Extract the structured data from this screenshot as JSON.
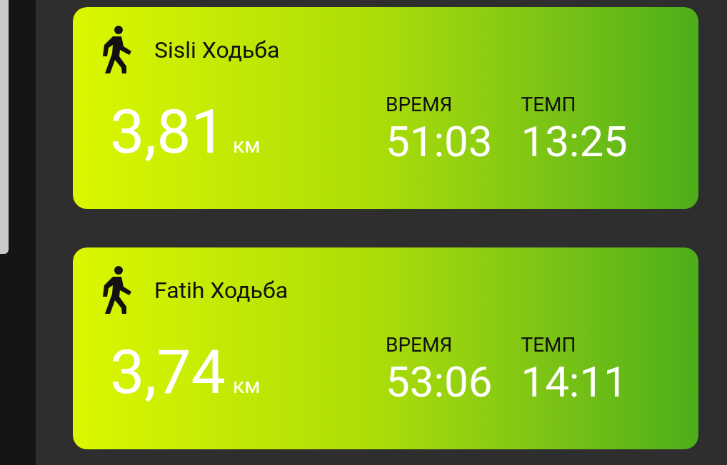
{
  "activities": [
    {
      "title": "Sisli Ходьба",
      "distance": "3,81",
      "unit": "км",
      "stats": [
        {
          "label": "ВРЕМЯ",
          "value": "51:03"
        },
        {
          "label": "ТЕМП",
          "value": "13:25"
        }
      ]
    },
    {
      "title": "Fatih Ходьба",
      "distance": "3,74",
      "unit": "км",
      "stats": [
        {
          "label": "ВРЕМЯ",
          "value": "53:06"
        },
        {
          "label": "ТЕМП",
          "value": "14:11"
        }
      ]
    }
  ]
}
